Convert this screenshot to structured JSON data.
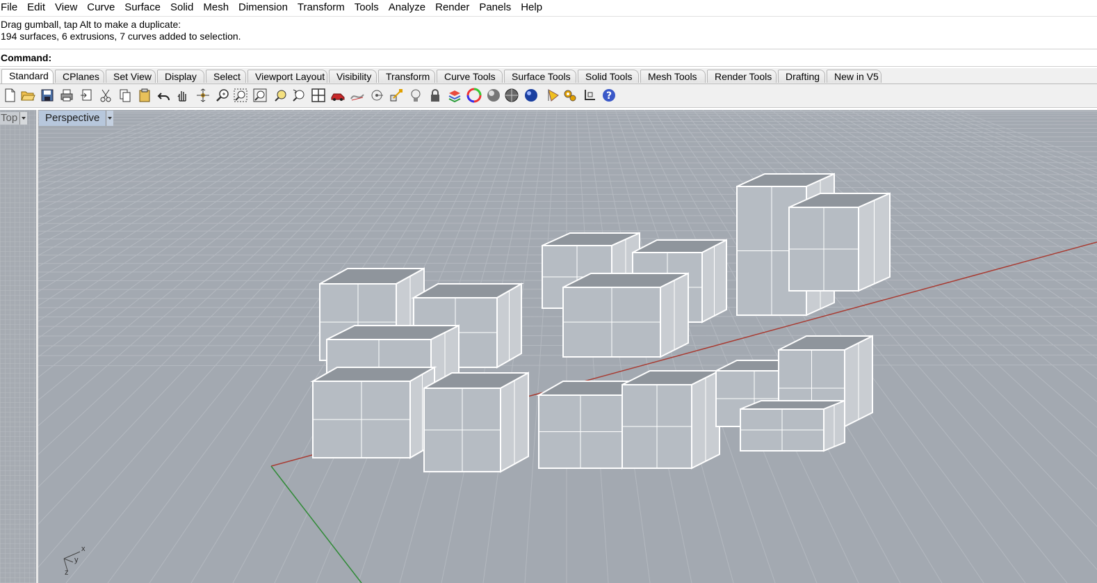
{
  "menu": [
    "File",
    "Edit",
    "View",
    "Curve",
    "Surface",
    "Solid",
    "Mesh",
    "Dimension",
    "Transform",
    "Tools",
    "Analyze",
    "Render",
    "Panels",
    "Help"
  ],
  "history": {
    "line1": "Drag gumball, tap Alt to make a duplicate:",
    "line2": "194 surfaces, 6 extrusions, 7 curves added to selection."
  },
  "command": {
    "label": "Command:",
    "value": ""
  },
  "tabs": [
    "Standard",
    "CPlanes",
    "Set View",
    "Display",
    "Select",
    "Viewport Layout",
    "Visibility",
    "Transform",
    "Curve Tools",
    "Surface Tools",
    "Solid Tools",
    "Mesh Tools",
    "Render Tools",
    "Drafting",
    "New in V5"
  ],
  "active_tab": "Standard",
  "toolbar_icons": [
    "new-file-icon",
    "open-folder-icon",
    "save-icon",
    "print-icon",
    "import-icon",
    "cut-icon",
    "copy-icon",
    "paste-icon",
    "undo-icon",
    "pan-hand-icon",
    "rotate-view-icon",
    "zoom-dynamic-icon",
    "zoom-window-icon",
    "zoom-extents-icon",
    "zoom-selected-icon",
    "zoom-previous-icon",
    "four-viewports-icon",
    "car-options-icon",
    "curve-options-icon",
    "object-snap-icon",
    "gumball-icon",
    "light-bulb-icon",
    "lock-icon",
    "layer-icon",
    "color-wheel-icon",
    "shaded-sphere-icon",
    "rendered-sphere-icon",
    "blue-sphere-icon",
    "render-cone-icon",
    "settings-gears-icon",
    "transform-axes-icon",
    "help-icon"
  ],
  "viewports": {
    "top": "Top",
    "perspective": "Perspective"
  },
  "axis_labels": {
    "x": "x",
    "y": "y",
    "z": "z"
  },
  "colors": {
    "viewport_bg": "#a3a9b1",
    "grid": "#b3b8bf",
    "x_axis": "#a83b32",
    "y_axis": "#2f8a36",
    "label_bg": "#b7c7dc"
  }
}
